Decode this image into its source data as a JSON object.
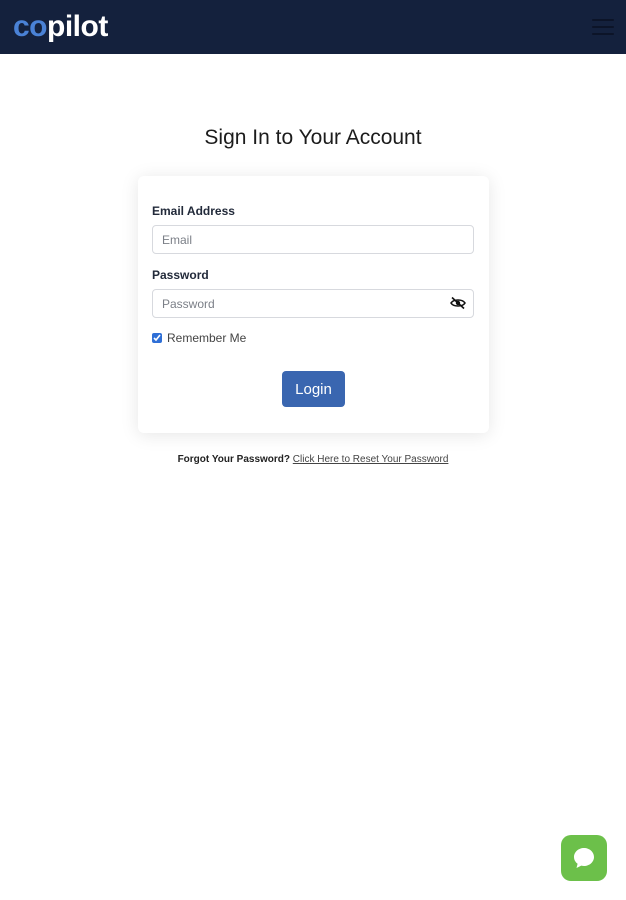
{
  "header": {
    "logo_part1": "co",
    "logo_part2": "pilot",
    "menu_icon": "hamburger-menu-icon",
    "background_color": "#14213d",
    "logo_accent_color": "#4a82d6"
  },
  "page": {
    "title": "Sign In to Your Account"
  },
  "form": {
    "email_label": "Email Address",
    "email_placeholder": "Email",
    "email_value": "",
    "password_label": "Password",
    "password_placeholder": "Password",
    "password_value": "",
    "password_toggle_icon": "eye-slash-icon",
    "remember_label": "Remember Me",
    "remember_checked": true,
    "login_label": "Login",
    "login_color": "#3a66b0"
  },
  "footer": {
    "forgot_question": "Forgot Your Password?",
    "reset_link": "Click Here to Reset Your Password"
  },
  "chat_widget": {
    "icon": "chat-bubble-icon",
    "color": "#6cc04a"
  }
}
